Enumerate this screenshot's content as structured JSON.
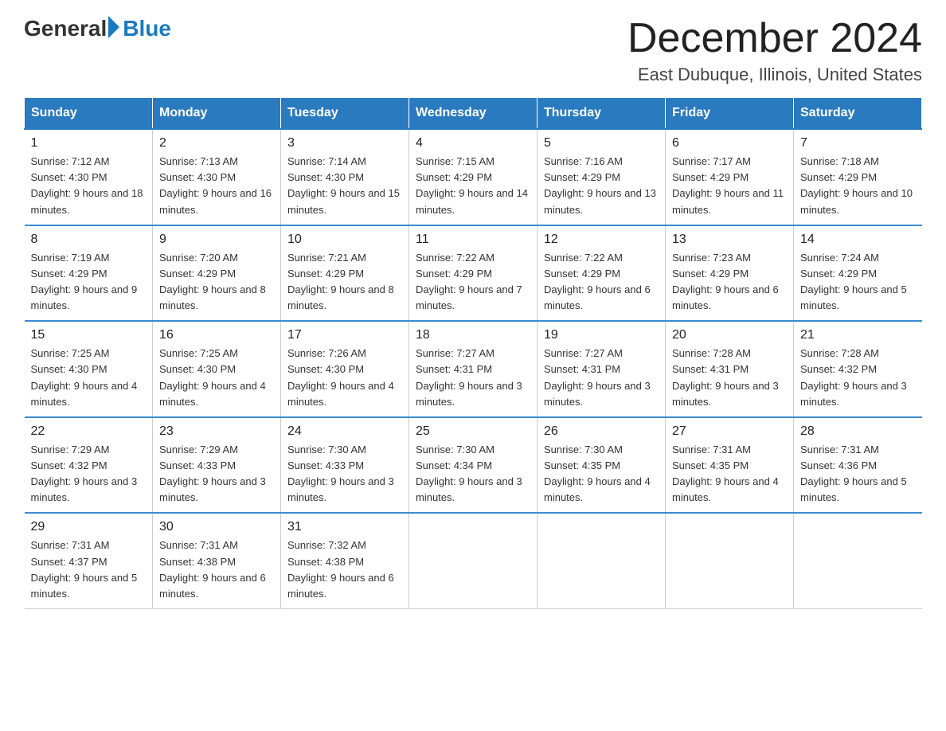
{
  "logo": {
    "general_text": "General",
    "blue_text": "Blue"
  },
  "title": {
    "month": "December 2024",
    "location": "East Dubuque, Illinois, United States"
  },
  "weekdays": [
    "Sunday",
    "Monday",
    "Tuesday",
    "Wednesday",
    "Thursday",
    "Friday",
    "Saturday"
  ],
  "weeks": [
    [
      {
        "day": "1",
        "sunrise": "7:12 AM",
        "sunset": "4:30 PM",
        "daylight": "9 hours and 18 minutes."
      },
      {
        "day": "2",
        "sunrise": "7:13 AM",
        "sunset": "4:30 PM",
        "daylight": "9 hours and 16 minutes."
      },
      {
        "day": "3",
        "sunrise": "7:14 AM",
        "sunset": "4:30 PM",
        "daylight": "9 hours and 15 minutes."
      },
      {
        "day": "4",
        "sunrise": "7:15 AM",
        "sunset": "4:29 PM",
        "daylight": "9 hours and 14 minutes."
      },
      {
        "day": "5",
        "sunrise": "7:16 AM",
        "sunset": "4:29 PM",
        "daylight": "9 hours and 13 minutes."
      },
      {
        "day": "6",
        "sunrise": "7:17 AM",
        "sunset": "4:29 PM",
        "daylight": "9 hours and 11 minutes."
      },
      {
        "day": "7",
        "sunrise": "7:18 AM",
        "sunset": "4:29 PM",
        "daylight": "9 hours and 10 minutes."
      }
    ],
    [
      {
        "day": "8",
        "sunrise": "7:19 AM",
        "sunset": "4:29 PM",
        "daylight": "9 hours and 9 minutes."
      },
      {
        "day": "9",
        "sunrise": "7:20 AM",
        "sunset": "4:29 PM",
        "daylight": "9 hours and 8 minutes."
      },
      {
        "day": "10",
        "sunrise": "7:21 AM",
        "sunset": "4:29 PM",
        "daylight": "9 hours and 8 minutes."
      },
      {
        "day": "11",
        "sunrise": "7:22 AM",
        "sunset": "4:29 PM",
        "daylight": "9 hours and 7 minutes."
      },
      {
        "day": "12",
        "sunrise": "7:22 AM",
        "sunset": "4:29 PM",
        "daylight": "9 hours and 6 minutes."
      },
      {
        "day": "13",
        "sunrise": "7:23 AM",
        "sunset": "4:29 PM",
        "daylight": "9 hours and 6 minutes."
      },
      {
        "day": "14",
        "sunrise": "7:24 AM",
        "sunset": "4:29 PM",
        "daylight": "9 hours and 5 minutes."
      }
    ],
    [
      {
        "day": "15",
        "sunrise": "7:25 AM",
        "sunset": "4:30 PM",
        "daylight": "9 hours and 4 minutes."
      },
      {
        "day": "16",
        "sunrise": "7:25 AM",
        "sunset": "4:30 PM",
        "daylight": "9 hours and 4 minutes."
      },
      {
        "day": "17",
        "sunrise": "7:26 AM",
        "sunset": "4:30 PM",
        "daylight": "9 hours and 4 minutes."
      },
      {
        "day": "18",
        "sunrise": "7:27 AM",
        "sunset": "4:31 PM",
        "daylight": "9 hours and 3 minutes."
      },
      {
        "day": "19",
        "sunrise": "7:27 AM",
        "sunset": "4:31 PM",
        "daylight": "9 hours and 3 minutes."
      },
      {
        "day": "20",
        "sunrise": "7:28 AM",
        "sunset": "4:31 PM",
        "daylight": "9 hours and 3 minutes."
      },
      {
        "day": "21",
        "sunrise": "7:28 AM",
        "sunset": "4:32 PM",
        "daylight": "9 hours and 3 minutes."
      }
    ],
    [
      {
        "day": "22",
        "sunrise": "7:29 AM",
        "sunset": "4:32 PM",
        "daylight": "9 hours and 3 minutes."
      },
      {
        "day": "23",
        "sunrise": "7:29 AM",
        "sunset": "4:33 PM",
        "daylight": "9 hours and 3 minutes."
      },
      {
        "day": "24",
        "sunrise": "7:30 AM",
        "sunset": "4:33 PM",
        "daylight": "9 hours and 3 minutes."
      },
      {
        "day": "25",
        "sunrise": "7:30 AM",
        "sunset": "4:34 PM",
        "daylight": "9 hours and 3 minutes."
      },
      {
        "day": "26",
        "sunrise": "7:30 AM",
        "sunset": "4:35 PM",
        "daylight": "9 hours and 4 minutes."
      },
      {
        "day": "27",
        "sunrise": "7:31 AM",
        "sunset": "4:35 PM",
        "daylight": "9 hours and 4 minutes."
      },
      {
        "day": "28",
        "sunrise": "7:31 AM",
        "sunset": "4:36 PM",
        "daylight": "9 hours and 5 minutes."
      }
    ],
    [
      {
        "day": "29",
        "sunrise": "7:31 AM",
        "sunset": "4:37 PM",
        "daylight": "9 hours and 5 minutes."
      },
      {
        "day": "30",
        "sunrise": "7:31 AM",
        "sunset": "4:38 PM",
        "daylight": "9 hours and 6 minutes."
      },
      {
        "day": "31",
        "sunrise": "7:32 AM",
        "sunset": "4:38 PM",
        "daylight": "9 hours and 6 minutes."
      },
      null,
      null,
      null,
      null
    ]
  ],
  "labels": {
    "sunrise": "Sunrise:",
    "sunset": "Sunset:",
    "daylight": "Daylight:"
  }
}
